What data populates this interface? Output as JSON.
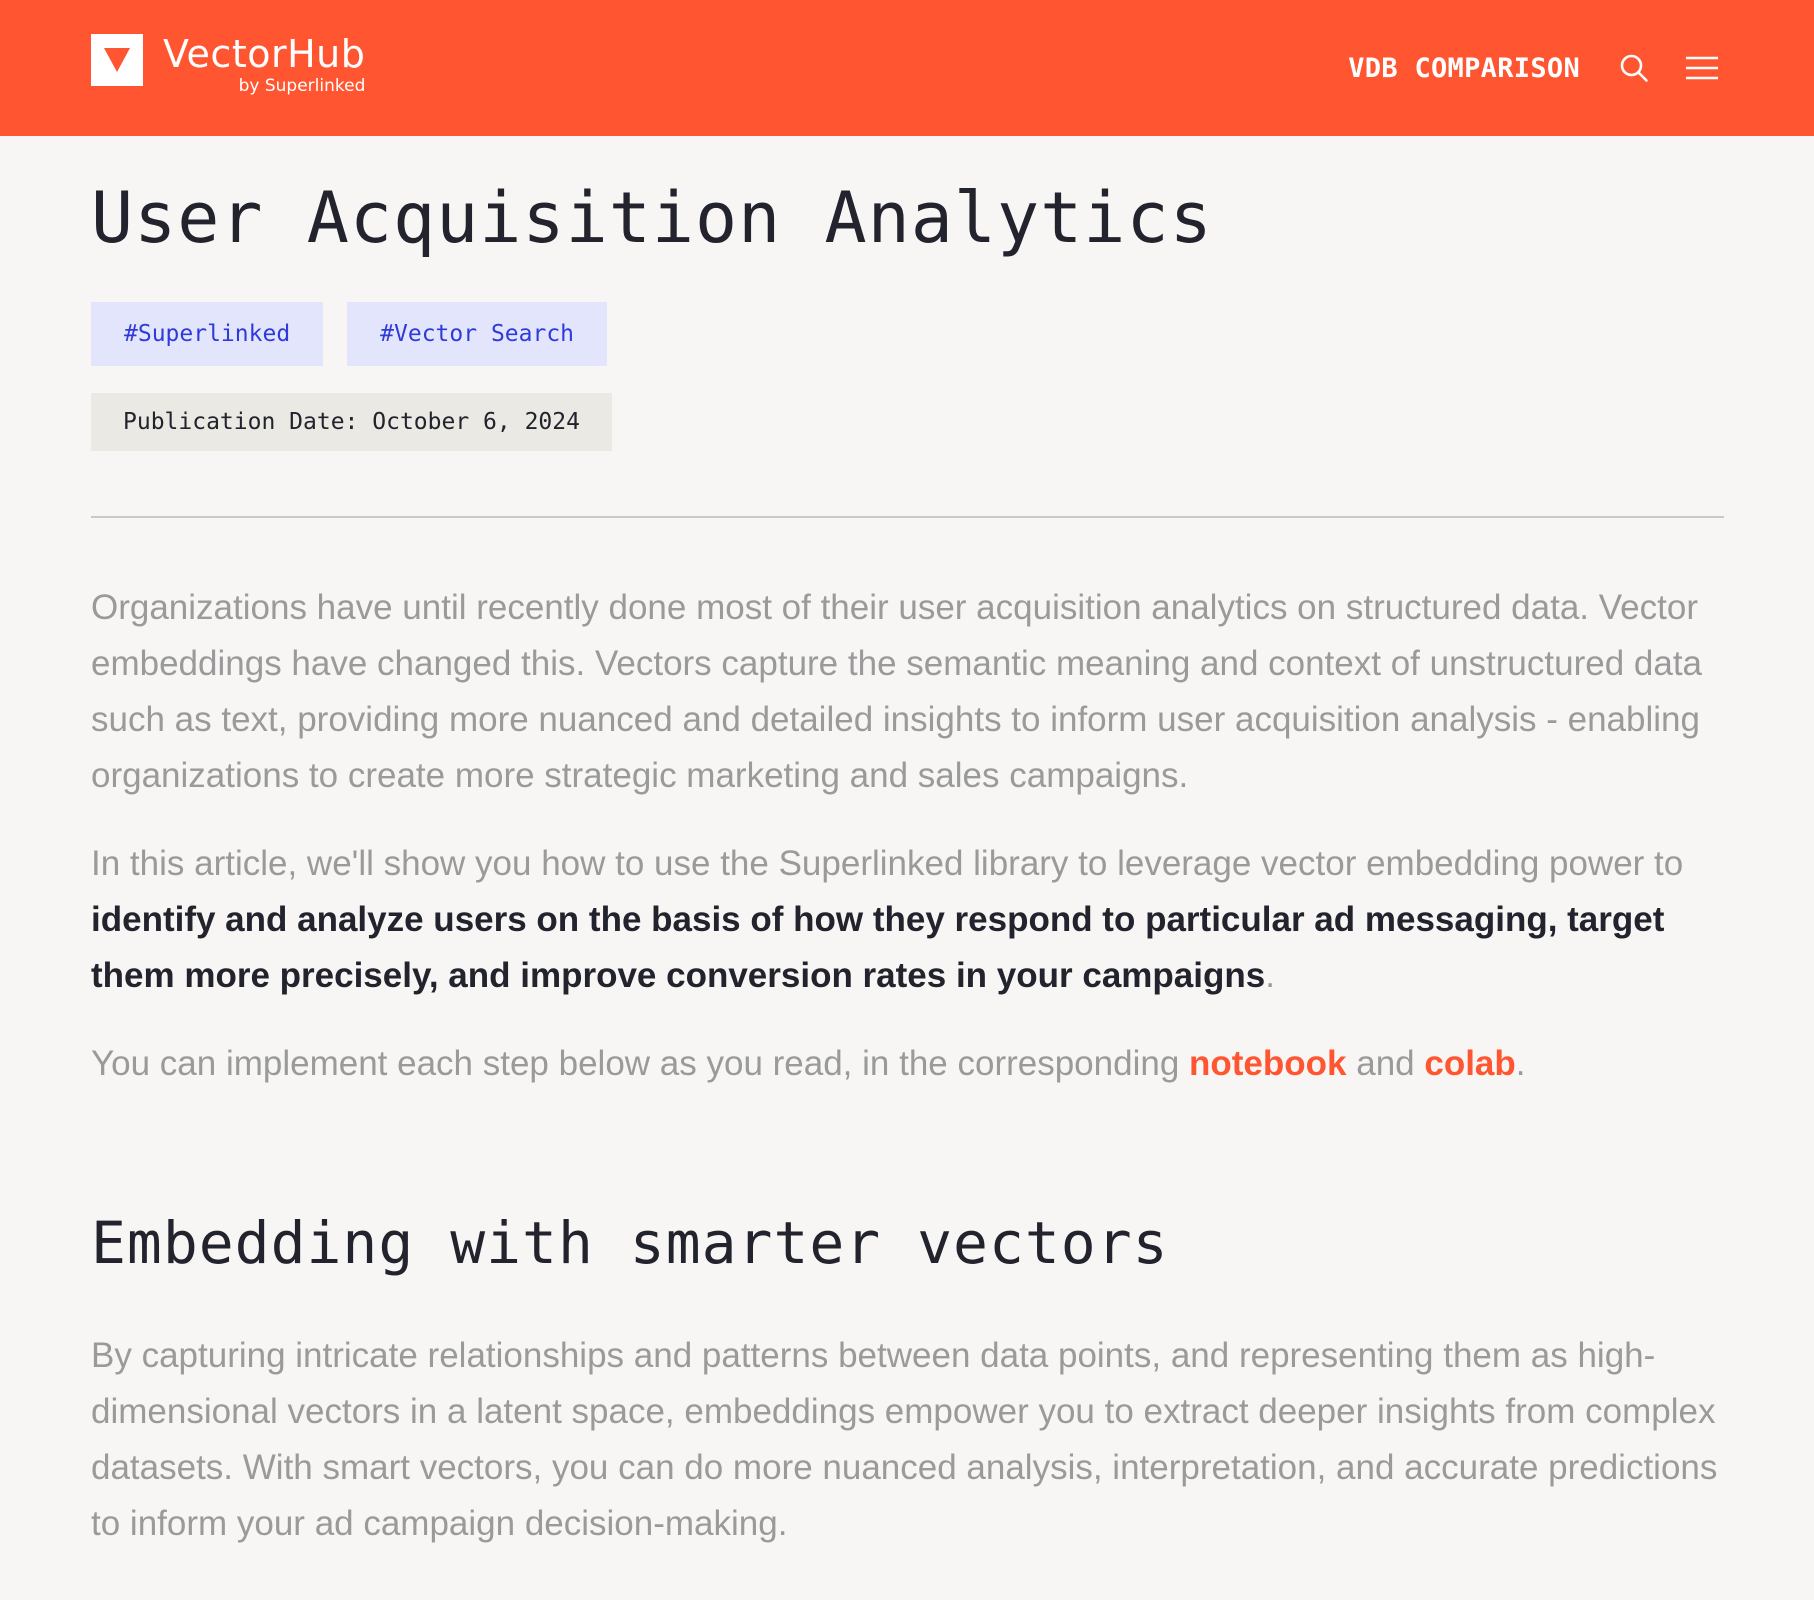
{
  "colors": {
    "brand": "#ff5530",
    "tag_bg": "#e3e5fd",
    "tag_text": "#2f3bd9",
    "date_bg": "#ebe9e3",
    "page_bg": "#f7f6f4",
    "heading": "#23232e",
    "body_text": "#9a9a9a"
  },
  "header": {
    "logo_name": "VectorHub",
    "logo_sub": "by Superlinked",
    "logo_icon": "triangle-down-logo",
    "nav_link": "VDB COMPARISON",
    "search_icon": "search-icon",
    "menu_icon": "hamburger-menu-icon"
  },
  "article": {
    "title": "User Acquisition Analytics",
    "tags": [
      "#Superlinked",
      "#Vector Search"
    ],
    "publication_date": "Publication Date: October 6, 2024",
    "p1": "Organizations have until recently done most of their user acquisition analytics on structured data. Vector embeddings have changed this. Vectors capture the semantic meaning and context of unstructured data such as text, providing more nuanced and detailed insights to inform user acquisition analysis - enabling organizations to create more strategic marketing and sales campaigns.",
    "p2_start": "In this article, we'll show you how to use the Superlinked library to leverage vector embedding power to ",
    "p2_bold": "identify and analyze users on the basis of how they respond to particular ad messaging, target them more precisely, and improve conversion rates in your campaigns",
    "p2_end": ".",
    "p3_start": "You can implement each step below as you read, in the corresponding ",
    "p3_link1": "notebook",
    "p3_mid": " and ",
    "p3_link2": "colab",
    "p3_end": ".",
    "section_title": "Embedding with smarter vectors",
    "p4": "By capturing intricate relationships and patterns between data points, and representing them as high-dimensional vectors in a latent space, embeddings empower you to extract deeper insights from complex datasets. With smart vectors, you can do more nuanced analysis, interpretation, and accurate predictions to inform your ad campaign decision-making."
  }
}
